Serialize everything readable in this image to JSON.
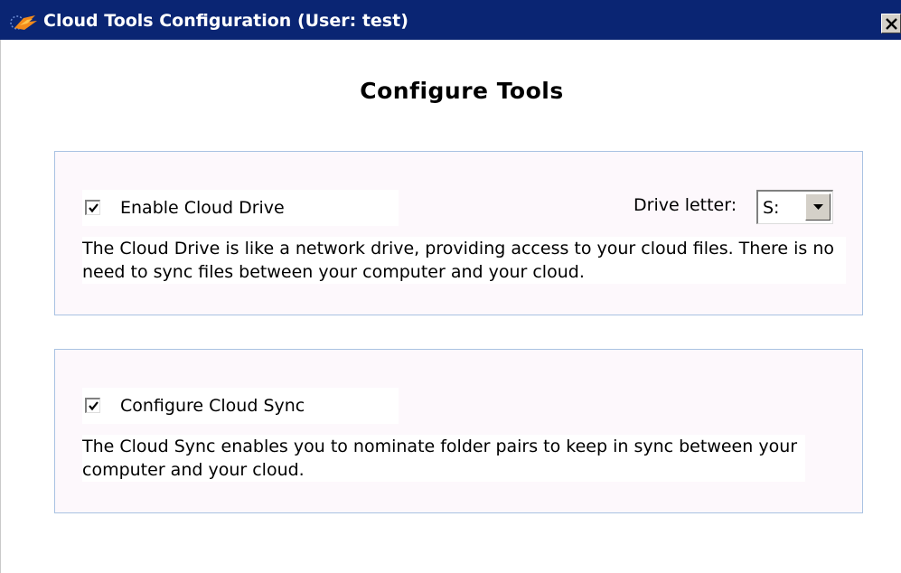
{
  "window": {
    "title": "Cloud Tools Configuration (User: test)",
    "titlebar_color": "#0a2573",
    "icon": "cloud-tools-app-icon",
    "close_icon": "close-icon"
  },
  "heading": "Configure Tools",
  "cloud_drive": {
    "enabled": true,
    "checkbox_label": "Enable Cloud Drive",
    "drive_letter_label": "Drive letter:",
    "drive_letter_value": "S:",
    "description": "The Cloud Drive is like a network drive, providing access to your cloud files. There is no need to sync files between your computer and your cloud."
  },
  "cloud_sync": {
    "enabled": true,
    "checkbox_label": "Configure Cloud Sync",
    "description": "The Cloud Sync enables you to nominate folder pairs to keep in sync between your computer and your cloud."
  },
  "colors": {
    "panel_border": "#a9c2e2",
    "panel_background": "#fdf8fc"
  }
}
